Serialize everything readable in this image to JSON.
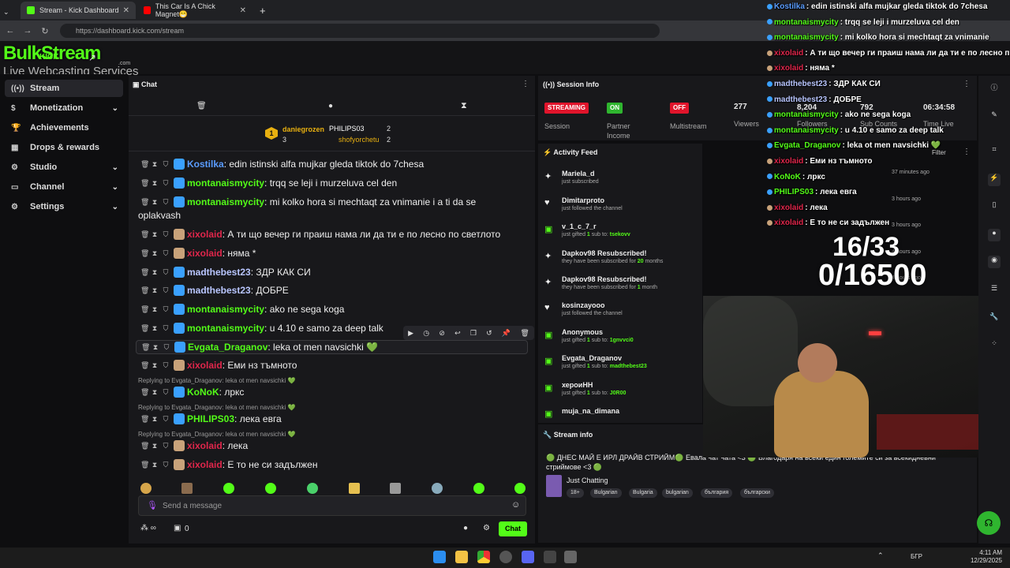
{
  "browser": {
    "tabs": [
      {
        "title": "Stream - Kick Dashboard"
      },
      {
        "title": "This Car Is A Chick Magnet😁"
      }
    ],
    "url": "https://dashboard.kick.com/stream"
  },
  "brand": {
    "logo_text": "BulkStream",
    "logo_kick": "KICK",
    "tagline": "Live Webcasting Services",
    "logo_sub": ".com"
  },
  "sidebar": {
    "items": [
      {
        "label": "Stream",
        "icon": "broadcast-icon"
      },
      {
        "label": "Monetization",
        "icon": "dollar-icon"
      },
      {
        "label": "Achievements",
        "icon": "trophy-icon"
      },
      {
        "label": "Drops & rewards",
        "icon": "gift-icon"
      },
      {
        "label": "Studio",
        "icon": "gear-icon"
      },
      {
        "label": "Channel",
        "icon": "channel-icon"
      },
      {
        "label": "Settings",
        "icon": "gear-icon"
      }
    ]
  },
  "chat": {
    "title": "Chat",
    "leaderboard": [
      {
        "rank": "1",
        "name": "daniegrozen",
        "count": "3"
      },
      {
        "name": "PHILIPS03",
        "count": "2"
      },
      {
        "name": "shofyorchetu",
        "count": "2"
      }
    ],
    "messages": [
      {
        "user": "Kostilka",
        "color": "#5a9cff",
        "text": ": edin istinski alfa mujkar gleda tiktok do 7chesa"
      },
      {
        "user": "montanaismycity",
        "color": "#53fc18",
        "text": ": trqq se leji i murzeluva cel den"
      },
      {
        "user": "montanaismycity",
        "color": "#53fc18",
        "text": ": mi kolko hora si mechtaqt za vnimanie i a ti da se",
        "text2": "oplakvash"
      },
      {
        "user": "xixolaid",
        "color": "#e0264b",
        "text": ": А ти що вечер ги праиш нама ли да ти е по лесно по светлото"
      },
      {
        "user": "xixolaid",
        "color": "#e0264b",
        "text": ": няма *"
      },
      {
        "user": "madthebest23",
        "color": "#b9c6ff",
        "text": ": ЗДР КАК СИ"
      },
      {
        "user": "madthebest23",
        "color": "#b9c6ff",
        "text": ": ДОБРЕ"
      },
      {
        "user": "montanaismycity",
        "color": "#53fc18",
        "text": ": ako ne sega koga"
      },
      {
        "user": "montanaismycity",
        "color": "#53fc18",
        "text": ": u 4.10 e samo za deep talk"
      },
      {
        "user": "Evgata_Draganov",
        "color": "#53fc18",
        "text": ": leka ot men navsichki 💚"
      },
      {
        "user": "xixolaid",
        "color": "#e0264b",
        "text": ": Еми нз тъмното"
      },
      {
        "user": "KoNoK",
        "color": "#53fc18",
        "text": ": лркс",
        "reply": "Replying to Evgata_Draganov: leka ot men navsichki 💚"
      },
      {
        "user": "PHILIPS03",
        "color": "#53fc18",
        "text": ": лека евга",
        "reply": "Replying to Evgata_Draganov: leka ot men navsichki 💚"
      },
      {
        "user": "xixolaid",
        "color": "#e0264b",
        "text": ": лека",
        "reply": "Replying to Evgata_Draganov: leka ot men navsichki 💚"
      },
      {
        "user": "xixolaid",
        "color": "#e0264b",
        "text": ": Е то не си задължен"
      }
    ],
    "input_placeholder": "Send a message",
    "points": "0",
    "send_label": "Chat"
  },
  "session": {
    "title": "Session Info",
    "items": [
      {
        "value": "STREAMING",
        "label": "Session",
        "color": "#e0142b"
      },
      {
        "value": "ON",
        "label": "Partner",
        "label2": "Income",
        "color": "#2fb52f"
      },
      {
        "value": "OFF",
        "label": "Multistream",
        "color": "#e0142b"
      },
      {
        "value": "277",
        "label": "Viewers"
      },
      {
        "value": "8,204",
        "label": "Followers"
      },
      {
        "value": "792",
        "label": "Sub Counts"
      },
      {
        "value": "06:34:58",
        "label": "Time Live"
      }
    ]
  },
  "activity": {
    "title": "Activity Feed",
    "filter": "Filter",
    "items": [
      {
        "name": "Mariela_d",
        "desc": "just subscribed",
        "time": "37 minutes ago",
        "icon": "star-icon"
      },
      {
        "name": "Dimitarproto",
        "desc": "just followed the channel",
        "time": "3 hours ago",
        "icon": "heart-icon"
      },
      {
        "name": "v_1_c_7_r",
        "desc": "just gifted ",
        "n": "1",
        "desc2": " sub to: ",
        "target": "tsekovv",
        "time": "3 hours ago",
        "icon": "gift-icon"
      },
      {
        "name": "Dapkov98 Resubscribed!",
        "desc": "they have been subscribed for ",
        "n": "20",
        "desc2": " months",
        "time": "4 hours ago",
        "icon": "star-icon"
      },
      {
        "name": "Dapkov98 Resubscribed!",
        "desc": "they have been subscribed for ",
        "n": "1",
        "desc2": " month",
        "time": "4 hours ago",
        "icon": "star-icon"
      },
      {
        "name": "kosinzayooo",
        "desc": "just followed the channel",
        "icon": "heart-icon"
      },
      {
        "name": "Anonymous",
        "desc": "just gifted ",
        "n": "1",
        "desc2": " sub to: ",
        "target": "1gnvvci0",
        "icon": "gift-icon"
      },
      {
        "name": "Evgata_Draganov",
        "desc": "just gifted ",
        "n": "1",
        "desc2": " sub to: ",
        "target": "madthebest23",
        "icon": "gift-icon"
      },
      {
        "name": "хероиНН",
        "desc": "just gifted ",
        "n": "1",
        "desc2": " sub to: ",
        "target": "J0R00",
        "icon": "gift-icon"
      },
      {
        "name": "muja_na_dimana",
        "icon": "gift-icon"
      }
    ]
  },
  "stream_info": {
    "title": "Stream info",
    "stream_title": "🟢 ДНЕС МАЙ Е ИРЛ ДРАЙВ СТРИЙМ🟢 Евала чат чата <3 🟢 Благодаря на всеки един големите си за всекидневни",
    "stream_title2": "стриймове <3 🟢",
    "category": "Just Chatting",
    "tags": [
      "18+",
      "Bulgarian",
      "Bulgaria",
      "bulgarian",
      "българия",
      "български"
    ]
  },
  "overlay": {
    "messages": [
      {
        "user": "Kostilka",
        "color": "#5a9cff",
        "text": ": edin istinski alfa mujkar gleda tiktok do 7chesa"
      },
      {
        "user": "montanaismycity",
        "color": "#53fc18",
        "text": ": trqq se leji i murzeluva cel den"
      },
      {
        "user": "montanaismycity",
        "color": "#53fc18",
        "text": ": mi kolko hora si mechtaqt za vnimanie"
      },
      {
        "user": "xixolaid",
        "color": "#e0264b",
        "text": ": А ти що вечер ги праиш нама ли да ти е по лесно п"
      },
      {
        "user": "xixolaid",
        "color": "#e0264b",
        "text": ": няма *"
      },
      {
        "user": "madthebest23",
        "color": "#b9c6ff",
        "text": ": ЗДР КАК СИ"
      },
      {
        "user": "madthebest23",
        "color": "#b9c6ff",
        "text": ": ДОБРЕ"
      },
      {
        "user": "montanaismycity",
        "color": "#53fc18",
        "text": ": ako ne sega koga"
      },
      {
        "user": "montanaismycity",
        "color": "#53fc18",
        "text": ": u 4.10 e samo za deep talk"
      },
      {
        "user": "Evgata_Draganov",
        "color": "#53fc18",
        "text": ": leka ot men navsichki 💚"
      },
      {
        "user": "xixolaid",
        "color": "#e0264b",
        "text": ": Еми нз тъмното"
      },
      {
        "user": "KoNoK",
        "color": "#53fc18",
        "text": ": лркс"
      },
      {
        "user": "PHILIPS03",
        "color": "#53fc18",
        "text": ": лека евга"
      },
      {
        "user": "xixolaid",
        "color": "#e0264b",
        "text": ": лека"
      },
      {
        "user": "xixolaid",
        "color": "#e0264b",
        "text": ": Е то не си задължен"
      }
    ],
    "counter1": "16/33",
    "counter2": "0/16500"
  },
  "taskbar": {
    "lang": "БГР",
    "time": "4:11 AM",
    "date": "12/29/2025"
  }
}
